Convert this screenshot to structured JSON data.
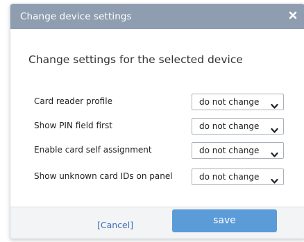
{
  "dialog": {
    "title": "Change device settings",
    "heading": "Change settings for the selected device",
    "settings": [
      {
        "label": "Card reader profile",
        "value": "do not change"
      },
      {
        "label": "Show PIN field first",
        "value": "do not change"
      },
      {
        "label": "Enable card self assignment",
        "value": "do not change"
      },
      {
        "label": "Show unknown card IDs on panel",
        "value": "do not change"
      }
    ],
    "cancel_label": "[Cancel]",
    "save_label": "save"
  },
  "colors": {
    "titlebar": "#8e9db0",
    "save_button": "#5b9bd8",
    "cancel_link": "#3b6fb4"
  },
  "icons": {
    "close": "close-icon",
    "dropdown": "chevron-down-icon"
  }
}
